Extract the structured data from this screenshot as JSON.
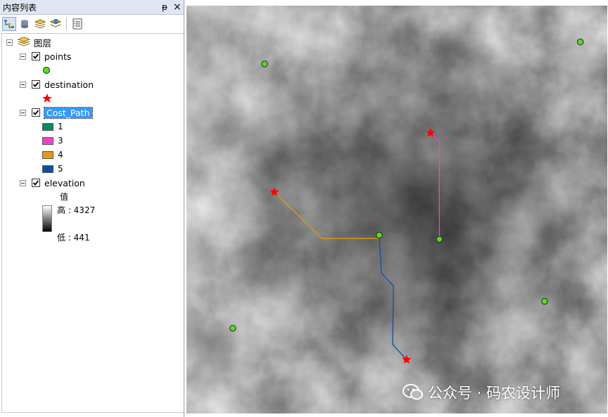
{
  "toc": {
    "title": "内容列表",
    "pin_glyph": "ᵽ",
    "close_glyph": "×",
    "toolbar": [
      "list-by-drawing-order-icon",
      "list-by-source-icon",
      "list-by-visibility-icon",
      "list-by-selection-icon",
      "options-icon"
    ],
    "root_label": "图层",
    "layers": {
      "points": {
        "label": "points",
        "checked": true,
        "symbol_color": "#55dd22"
      },
      "destination": {
        "label": "destination",
        "checked": true,
        "symbol_color": "#ff0000"
      },
      "cost_path": {
        "label": "Cost_Path",
        "checked": true,
        "classes": [
          {
            "label": "1",
            "color": "#0b8a5f"
          },
          {
            "label": "3",
            "color": "#ee44cc"
          },
          {
            "label": "4",
            "color": "#e49a12"
          },
          {
            "label": "5",
            "color": "#0c4fa0"
          }
        ]
      },
      "elevation": {
        "label": "elevation",
        "checked": true,
        "value_heading": "值",
        "high_label": "高 : 4327",
        "low_label": "低 : 441"
      }
    }
  },
  "map": {
    "points": [
      [
        0.186,
        0.143
      ],
      [
        0.936,
        0.089
      ],
      [
        0.458,
        0.563
      ],
      [
        0.601,
        0.573
      ],
      [
        0.851,
        0.725
      ],
      [
        0.11,
        0.791
      ]
    ],
    "destinations": [
      [
        0.209,
        0.457
      ],
      [
        0.58,
        0.312
      ],
      [
        0.523,
        0.868
      ]
    ],
    "paths": [
      {
        "class": "4",
        "coords": [
          [
            0.209,
            0.457
          ],
          [
            0.322,
            0.571
          ],
          [
            0.458,
            0.571
          ]
        ]
      },
      {
        "class": "3",
        "coords": [
          [
            0.58,
            0.312
          ],
          [
            0.601,
            0.331
          ],
          [
            0.601,
            0.573
          ]
        ]
      },
      {
        "class": "5",
        "coords": [
          [
            0.458,
            0.563
          ],
          [
            0.463,
            0.655
          ],
          [
            0.492,
            0.688
          ],
          [
            0.49,
            0.831
          ],
          [
            0.523,
            0.868
          ]
        ]
      }
    ]
  },
  "watermark": {
    "icon": "wechat-icon",
    "text": "公众号 · 码农设计师"
  }
}
